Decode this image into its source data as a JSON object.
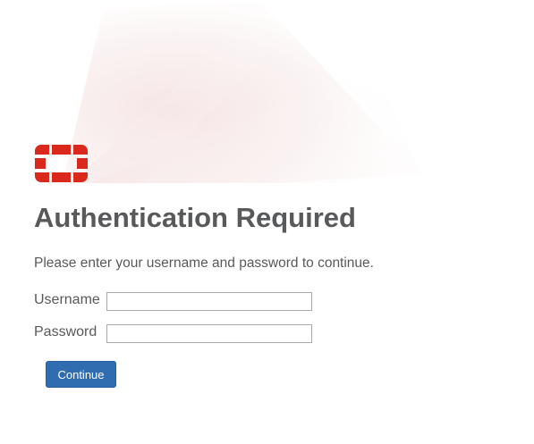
{
  "brand": {
    "logo_icon": "fortinet-logo-icon",
    "accent_color": "#da291c"
  },
  "page": {
    "title": "Authentication Required",
    "instructions": "Please enter your username and password to continue."
  },
  "form": {
    "username_label": "Username",
    "username_value": "",
    "password_label": "Password",
    "password_value": "",
    "submit_label": "Continue",
    "submit_color": "#2f6cb0"
  }
}
